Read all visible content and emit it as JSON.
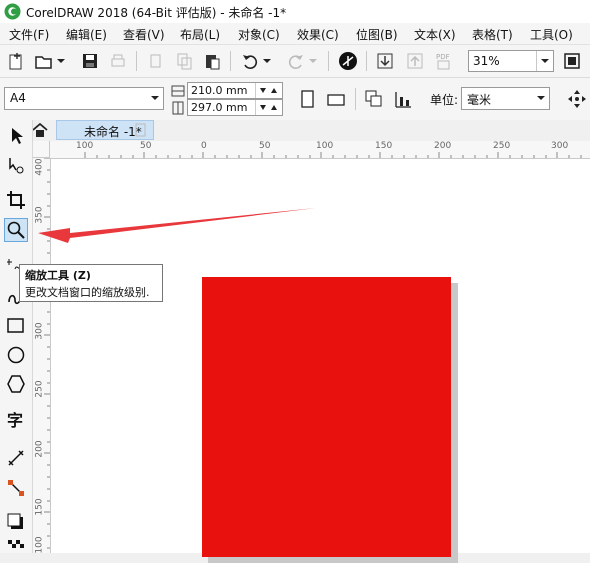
{
  "window": {
    "title": "CorelDRAW 2018 (64-Bit 评估版) - 未命名 -1*"
  },
  "menu": [
    {
      "label": "文件(F)"
    },
    {
      "label": "编辑(E)"
    },
    {
      "label": "查看(V)"
    },
    {
      "label": "布局(L)"
    },
    {
      "label": "对象(C)"
    },
    {
      "label": "效果(C)"
    },
    {
      "label": "位图(B)"
    },
    {
      "label": "文本(X)"
    },
    {
      "label": "表格(T)"
    },
    {
      "label": "工具(O)"
    }
  ],
  "toolbar": {
    "zoom_level": "31%"
  },
  "property_bar": {
    "page_size": "A4",
    "width": "210.0 mm",
    "height": "297.0 mm",
    "unit_label": "单位:",
    "unit_value": "毫米"
  },
  "document_tab": {
    "label": "未命名 -1*"
  },
  "ruler": {
    "h_labels": [
      "100",
      "50",
      "0",
      "50",
      "100",
      "150",
      "200",
      "250",
      "300"
    ],
    "v_labels": [
      "400",
      "350",
      "300",
      "250",
      "200",
      "150",
      "100"
    ]
  },
  "tooltip": {
    "title": "缩放工具 (Z)",
    "description": "更改文档窗口的缩放级别."
  },
  "colors": {
    "page_fill": "#e8110e",
    "annotation_arrow": "#e8383b",
    "tab_active": "#cfe3f7"
  }
}
